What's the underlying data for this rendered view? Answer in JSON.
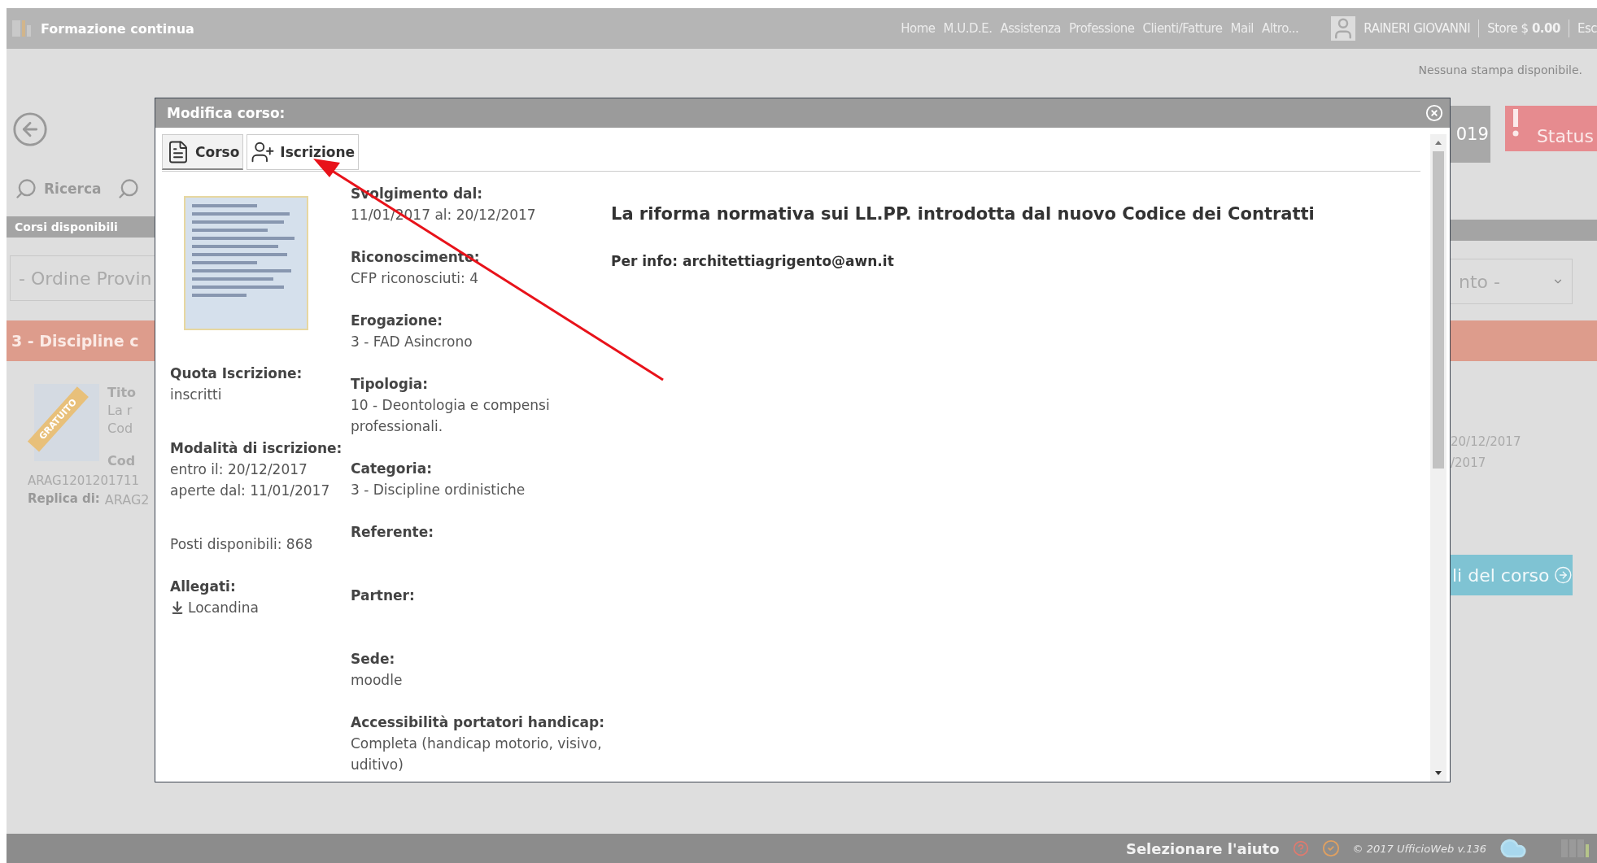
{
  "top_bar": {
    "title": "Formazione continua",
    "nav": [
      "Home",
      "M.U.D.E.",
      "Assistenza",
      "Professione",
      "Clienti/Fatture",
      "Mail",
      "Altro..."
    ],
    "user": "RAINERI GIOVANNI",
    "store": "Store $ **0.00**",
    "exit": "Esc"
  },
  "notice": "Nessuna stampa disponibile.",
  "left_panel": {
    "search": "Ricerca",
    "section_bar": "Corsi disponibili",
    "dropdown": "- Ordine Provin",
    "category_bar": "3 - Discipline c",
    "ribbon": "GRATUITO",
    "card_lines": [
      "Tito",
      "La r",
      "Cod"
    ],
    "code_label": "Cod",
    "code": "ARAG1201201711",
    "replica_label": "Replica di:",
    "replica": "ARAG2"
  },
  "right_panel": {
    "year": "019",
    "status": "Status",
    "dropdown": "nto -",
    "dates": [
      "20/12/2017",
      "/2017"
    ],
    "details_button": "li del corso"
  },
  "modal": {
    "title": "Modifica corso:",
    "tabs": [
      {
        "label": "Corso",
        "selected": true
      },
      {
        "label": "Iscrizione",
        "selected": false
      }
    ],
    "left_fields": [
      {
        "label": "Quota Iscrizione:",
        "lines": [
          "inscritti"
        ]
      },
      {
        "label": "Modalità di iscrizione:",
        "lines": [
          "entro il: 20/12/2017",
          "aperte dal: 11/01/2017"
        ]
      },
      {
        "lines": [
          "Posti disponibili: 868"
        ]
      }
    ],
    "attachments": {
      "label": "Allegati:",
      "file": "Locandina"
    },
    "fields": [
      {
        "label": "Svolgimento dal:",
        "value": "11/01/2017 al: 20/12/2017"
      },
      {
        "label": "Riconoscimento:",
        "value": "CFP riconosciuti: 4"
      },
      {
        "label": "Erogazione:",
        "value": "3 - FAD Asincrono"
      },
      {
        "label": "Tipologia:",
        "value": "10 - Deontologia e compensi professionali."
      },
      {
        "label": "Categoria:",
        "value": "3 - Discipline ordinistiche"
      },
      {
        "label": "Referente:"
      },
      {
        "label": "Partner:"
      },
      {
        "label": "Sede:",
        "value": "moodle"
      },
      {
        "label": "Accessibilità portatori handicap:",
        "value": "Completa (handicap motorio, visivo, uditivo)"
      }
    ],
    "course_title": "La riforma normativa sui LL.PP. introdotta dal nuovo Codice dei Contratti",
    "info": "Per info: architettiagrigento@awn.it"
  },
  "footer": {
    "help": "Selezionare l'aiuto",
    "copyright": "© 2017 UfficioWeb v.136"
  }
}
